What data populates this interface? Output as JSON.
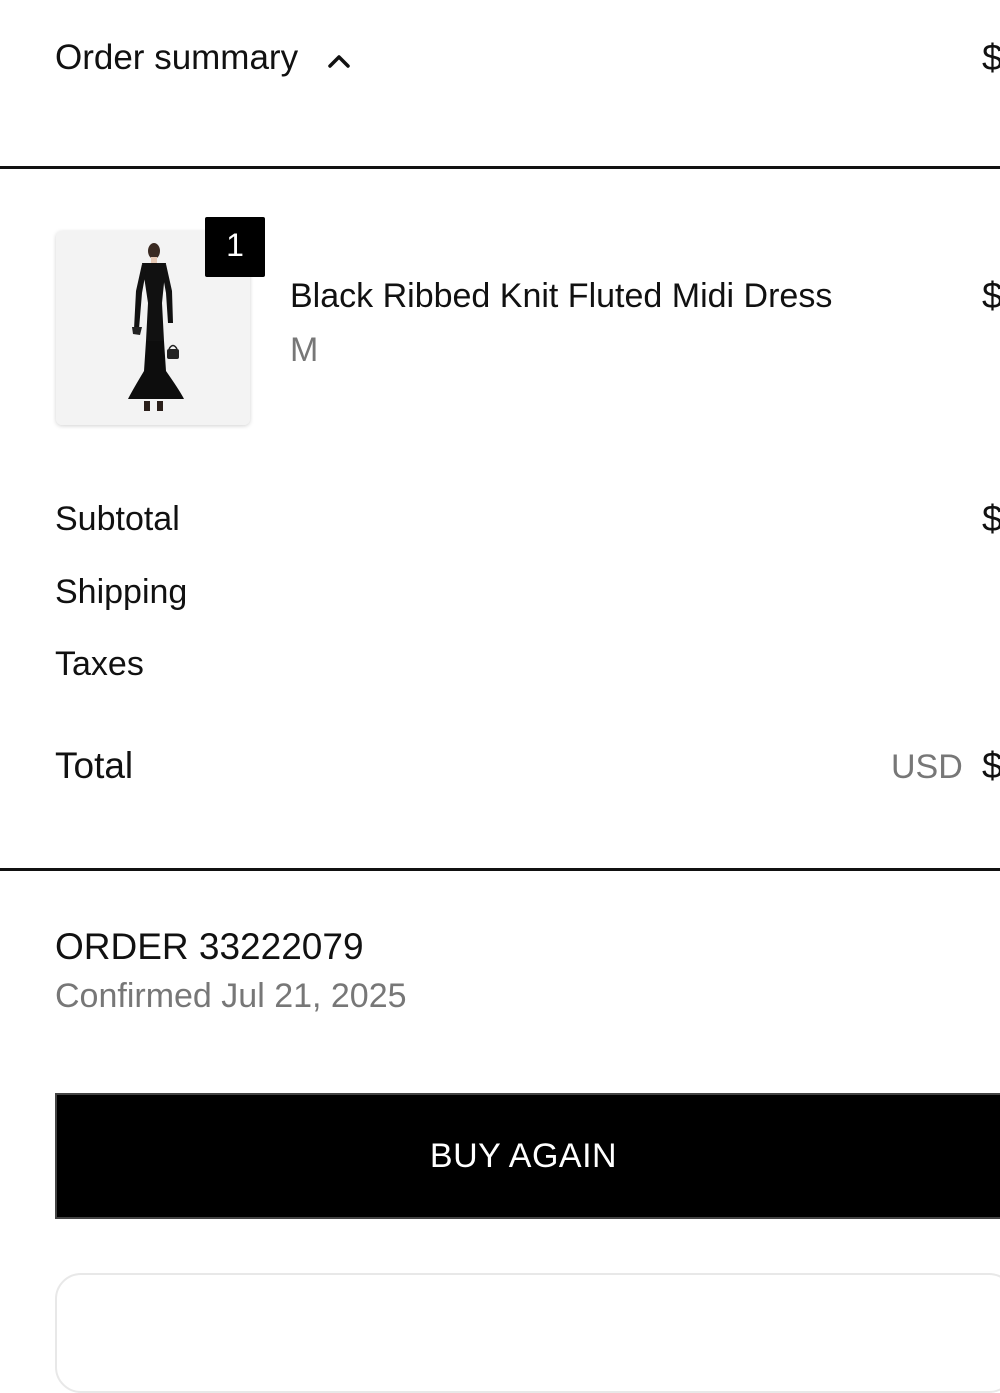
{
  "summary": {
    "title": "Order summary",
    "toggle_icon": "chevron-up-icon",
    "total_peek": "$"
  },
  "line_item": {
    "quantity": "1",
    "name": "Black Ribbed Knit Fluted Midi Dress",
    "variant": "M",
    "price_peek": "$",
    "image_icon": "dress-thumbnail"
  },
  "costs": {
    "subtotal_label": "Subtotal",
    "subtotal_peek": "$",
    "shipping_label": "Shipping",
    "taxes_label": "Taxes"
  },
  "total": {
    "label": "Total",
    "currency": "USD",
    "peek": "$"
  },
  "order": {
    "number": "ORDER 33222079",
    "confirmed": "Confirmed Jul 21, 2025"
  },
  "actions": {
    "buy_again_label": "BUY AGAIN"
  },
  "colors": {
    "text": "#111111",
    "muted": "#777777",
    "button_bg": "#000000",
    "button_text": "#ffffff"
  }
}
